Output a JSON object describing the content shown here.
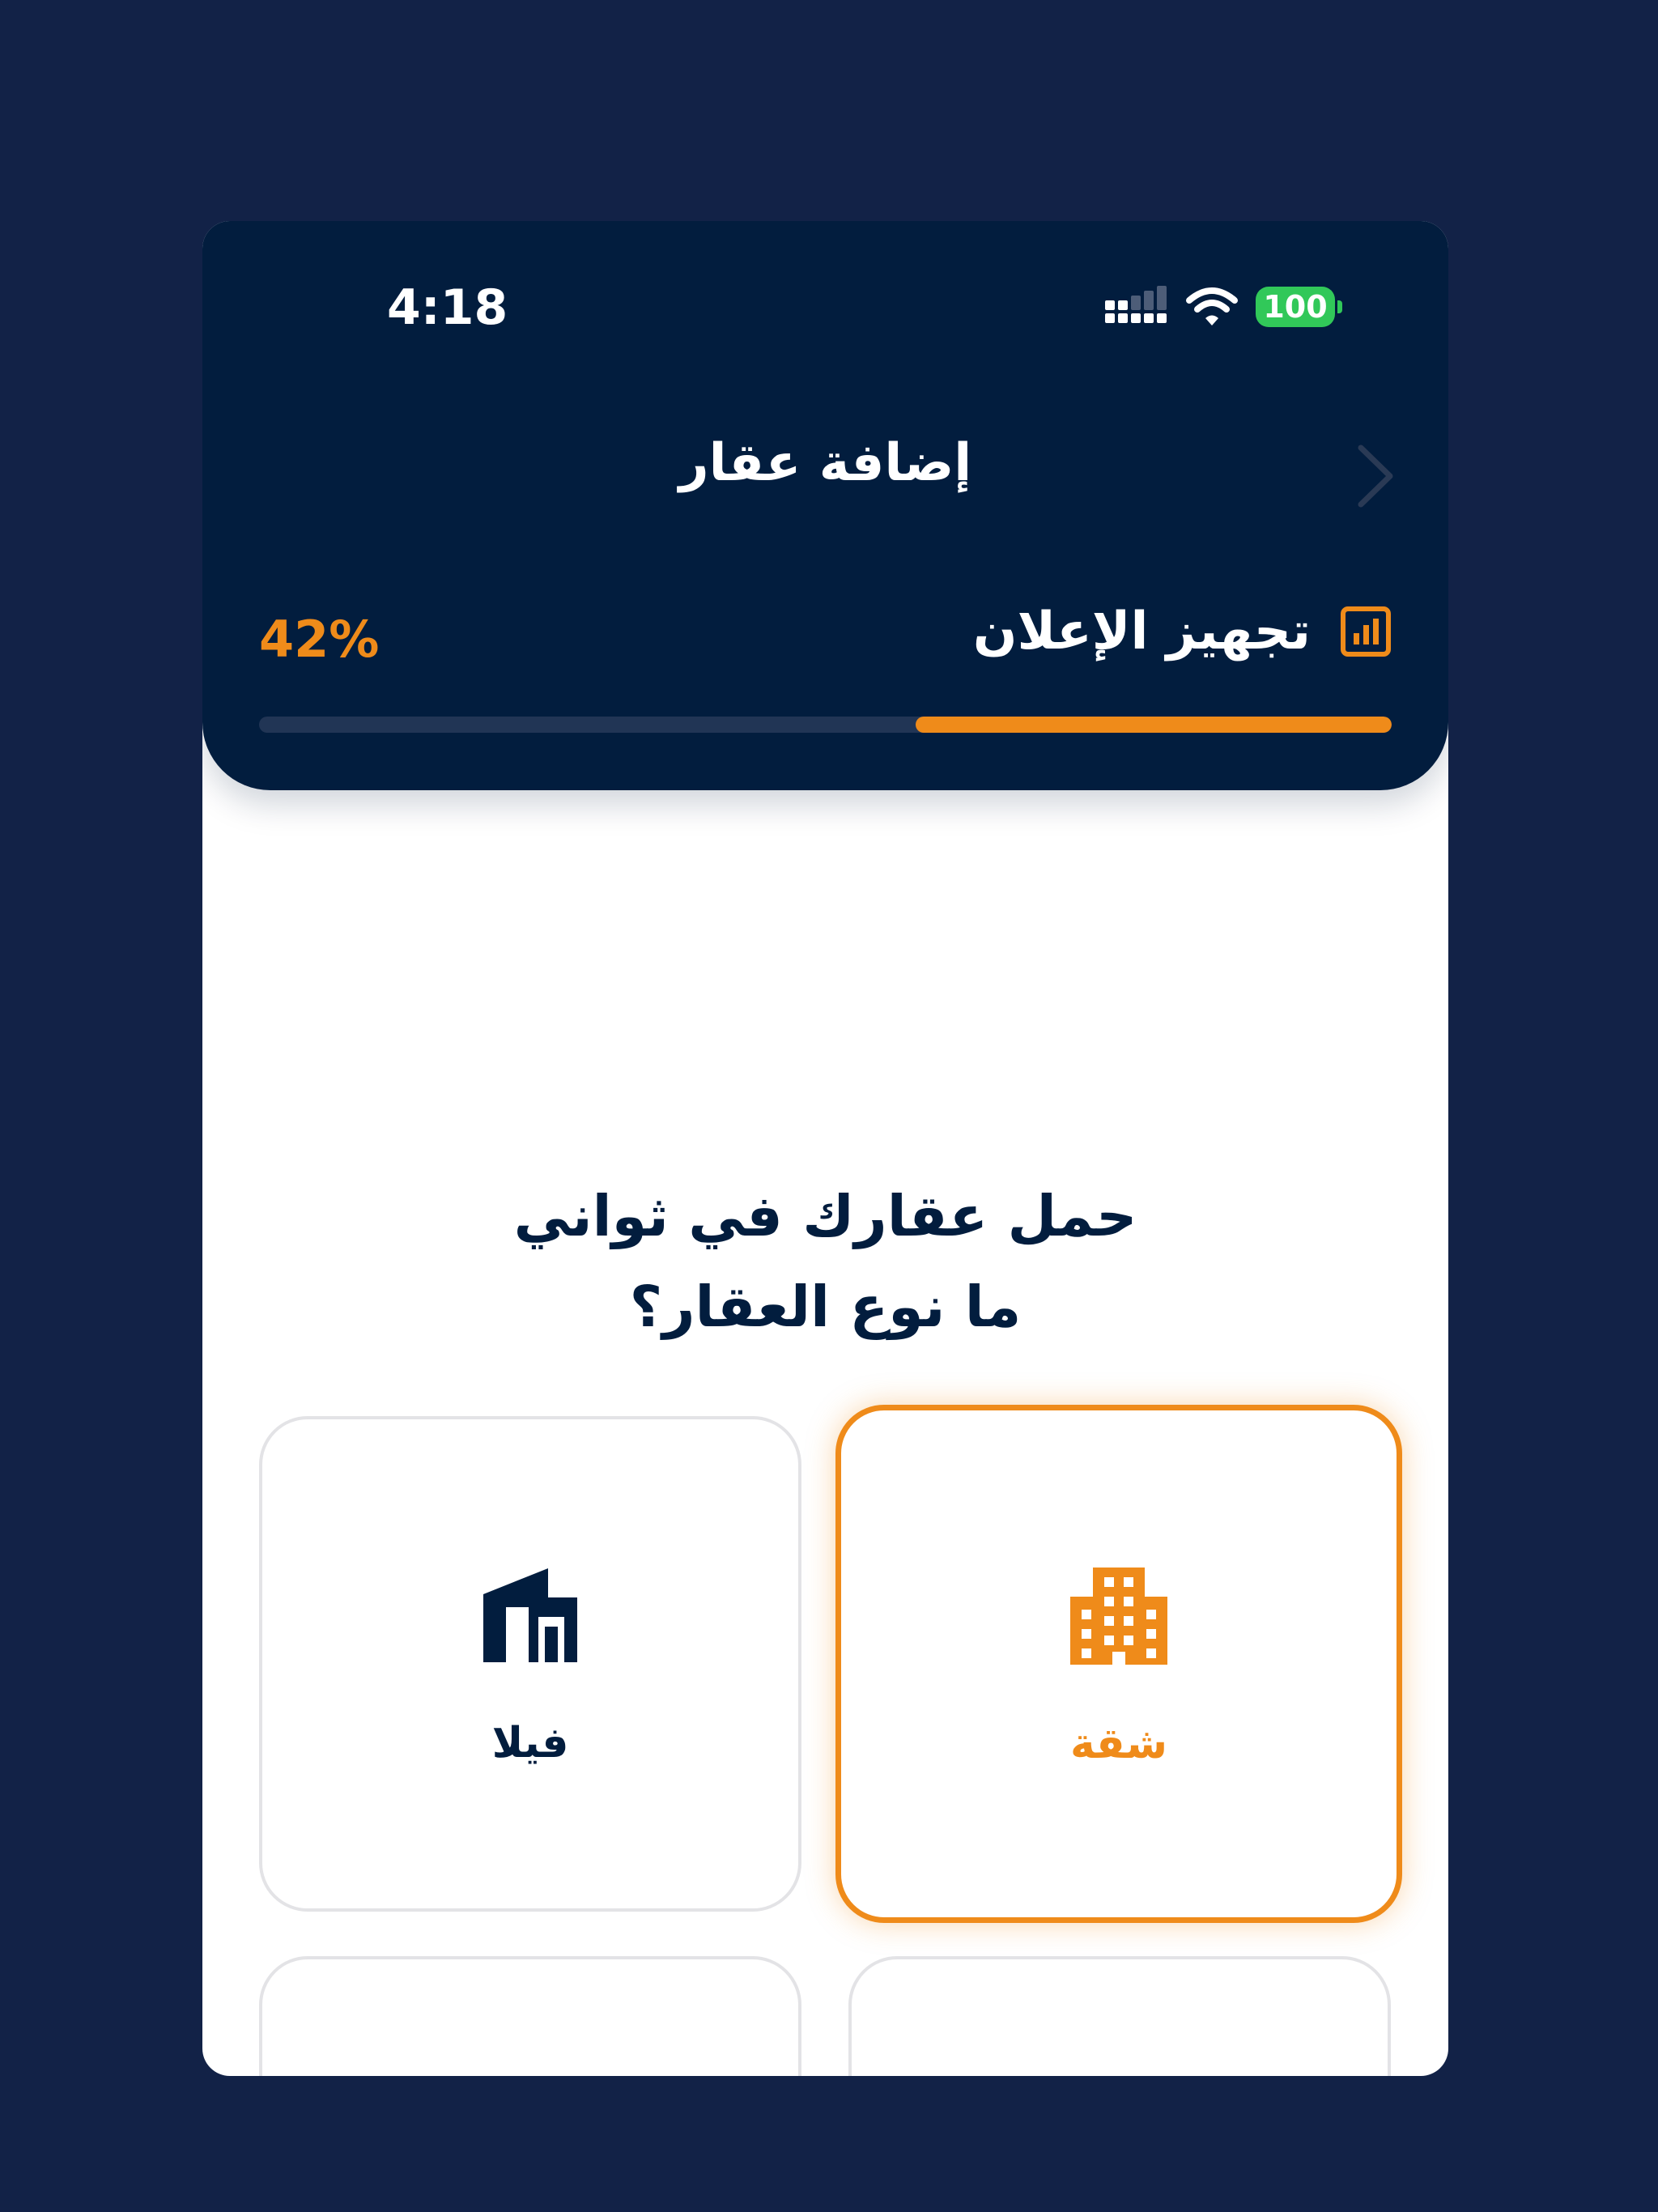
{
  "status_bar": {
    "time": "4:18",
    "battery": "100"
  },
  "header": {
    "title": "إضافة عقار"
  },
  "progress": {
    "step_label": "تجهيز الإعلان",
    "percent_label": "42%",
    "fraction": 0.42
  },
  "question": {
    "line1": "حمل عقارك في ثواني",
    "line2": "ما نوع العقار؟"
  },
  "property_types": [
    {
      "label": "شقة",
      "icon": "apartment-building-icon",
      "selected": true
    },
    {
      "label": "فيلا",
      "icon": "villa-icon",
      "selected": false
    }
  ],
  "colors": {
    "accent": "#ef8b1a",
    "navy": "#021d3e",
    "background": "#122247",
    "battery": "#31c859"
  }
}
